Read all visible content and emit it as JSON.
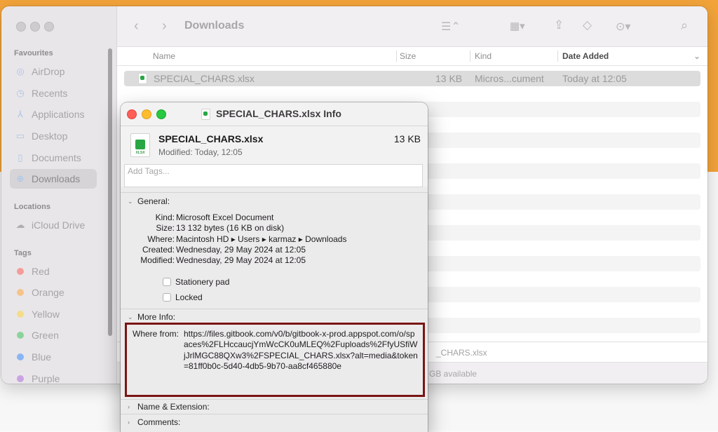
{
  "finder": {
    "title": "Downloads",
    "sidebar": {
      "favourites_label": "Favourites",
      "favourites": [
        {
          "label": "AirDrop",
          "icon": "airdrop-icon"
        },
        {
          "label": "Recents",
          "icon": "clock-icon"
        },
        {
          "label": "Applications",
          "icon": "applications-icon"
        },
        {
          "label": "Desktop",
          "icon": "desktop-icon"
        },
        {
          "label": "Documents",
          "icon": "document-icon"
        },
        {
          "label": "Downloads",
          "icon": "download-icon"
        }
      ],
      "locations_label": "Locations",
      "locations": [
        {
          "label": "iCloud Drive",
          "icon": "cloud-icon"
        }
      ],
      "tags_label": "Tags",
      "tags": [
        {
          "label": "Red",
          "color": "#ff5f57"
        },
        {
          "label": "Orange",
          "color": "#ffa63d"
        },
        {
          "label": "Yellow",
          "color": "#ffd43b"
        },
        {
          "label": "Green",
          "color": "#3cc55c"
        },
        {
          "label": "Blue",
          "color": "#3b8cff"
        },
        {
          "label": "Purple",
          "color": "#b36be0"
        }
      ]
    },
    "columns": {
      "name": "Name",
      "size": "Size",
      "kind": "Kind",
      "date_added": "Date Added"
    },
    "rows": [
      {
        "name": "SPECIAL_CHARS.xlsx",
        "size": "13 KB",
        "kind": "Micros...cument",
        "date": "Today at 12:05"
      }
    ],
    "path_fragment": "_CHARS.xlsx",
    "status_fragment": "GB available"
  },
  "info": {
    "window_title": "SPECIAL_CHARS.xlsx Info",
    "file_name": "SPECIAL_CHARS.xlsx",
    "file_size": "13 KB",
    "modified_summary": "Modified: Today, 12:05",
    "tags_placeholder": "Add Tags...",
    "general_label": "General:",
    "general": {
      "kind_key": "Kind:",
      "kind": "Microsoft Excel Document",
      "size_key": "Size:",
      "size": "13 132 bytes (16 KB on disk)",
      "where_key": "Where:",
      "where": "Macintosh HD ▸ Users ▸ karmaz ▸ Downloads",
      "created_key": "Created:",
      "created": "Wednesday, 29 May 2024 at 12:05",
      "modified_key": "Modified:",
      "modified": "Wednesday, 29 May 2024 at 12:05"
    },
    "stationery_label": "Stationery pad",
    "locked_label": "Locked",
    "more_info_label": "More Info:",
    "where_from_key": "Where from:",
    "where_from": "https://files.gitbook.com/v0/b/gitbook-x-prod.appspot.com/o/spaces%2FLHccaucjYmWcCK0uMLEQ%2Fuploads%2FfyUSfiWjJrlMGC88QXw3%2FSPECIAL_CHARS.xlsx?alt=media&token=81ff0b0c-5d40-4db5-9b70-aa8cf465880e",
    "name_ext_label": "Name & Extension:",
    "comments_label": "Comments:"
  },
  "colors": {
    "highlight_border": "#7a1515",
    "desktop": "#f2a33a"
  }
}
